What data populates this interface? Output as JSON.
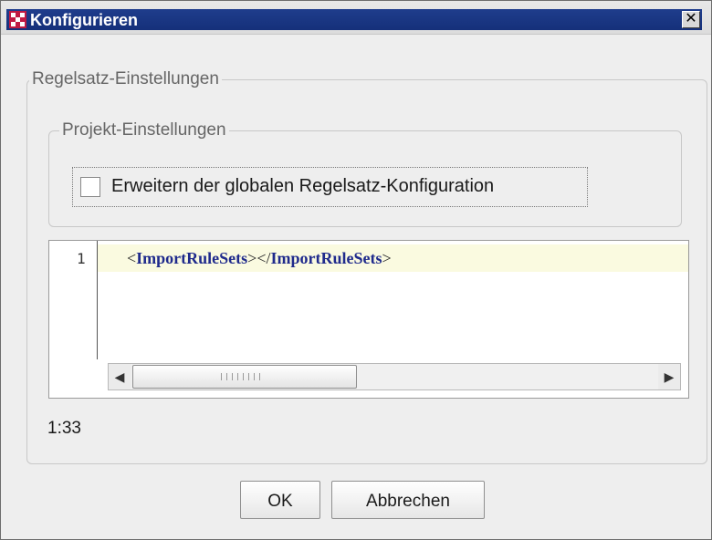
{
  "window": {
    "title": "Konfigurieren",
    "close_glyph": "✕",
    "icon": "app-icon-red-squares"
  },
  "ruleset_group": {
    "legend": "Regelsatz-Einstellungen"
  },
  "project_group": {
    "legend": "Projekt-Einstellungen",
    "checkbox": {
      "label": "Erweitern der globalen Regelsatz-Konfiguration",
      "checked": false
    }
  },
  "editor": {
    "line_number": "1",
    "code": {
      "open_lt": "<",
      "open_tag": "ImportRuleSets",
      "open_gt": ">",
      "close_lt": "</",
      "close_tag": "ImportRuleSets",
      "close_gt": ">"
    },
    "scroll_left_glyph": "◀",
    "scroll_right_glyph": "▶",
    "scroll_position_fraction": 0.0
  },
  "status": {
    "cursor_position": "1:33"
  },
  "buttons": {
    "ok": "OK",
    "cancel": "Abbrechen"
  },
  "colors": {
    "title_bar": "#1f3d8c",
    "app_icon": "#c01a43",
    "code_tag": "#1f2a8c",
    "current_line": "#fafae0"
  }
}
